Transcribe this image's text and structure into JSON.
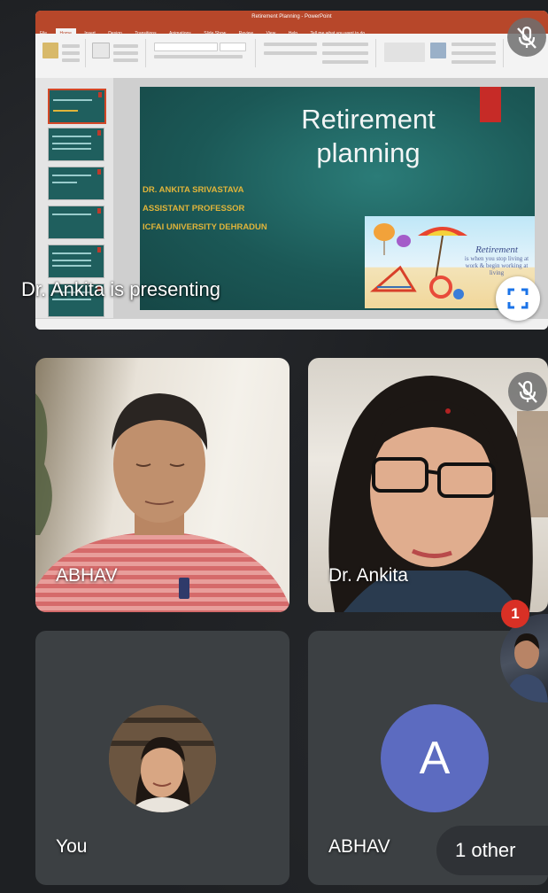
{
  "presentation": {
    "window_title": "Retirement Planning - PowerPoint",
    "ribbon_tabs": [
      "File",
      "Home",
      "Insert",
      "Design",
      "Transitions",
      "Animations",
      "Slide Show",
      "Review",
      "View",
      "Help",
      "Tell me what you want to do"
    ],
    "slide": {
      "title_line1": "Retirement",
      "title_line2": "planning",
      "author": "DR. ANKITA SRIVASTAVA",
      "role": "ASSISTANT PROFESSOR",
      "institution": "ICFAI UNIVERSITY DEHRADUN",
      "picture_heading": "Retirement",
      "picture_caption": "is when you stop living at work & begin working at living"
    },
    "thumbnail_count": 6,
    "presenting_label": "Dr. Ankita is presenting"
  },
  "participants": {
    "abhav_video_name": "ABHAV",
    "ankita_video_name": "Dr. Ankita",
    "self_name": "You",
    "abhav_avatar_letter": "A",
    "abhav_avatar_name": "ABHAV",
    "others_label": "1 other",
    "notification_count": "1"
  },
  "colors": {
    "background": "#1f2124",
    "tile": "#3c4043",
    "avatar_accent": "#5c6bc0",
    "badge": "#d93025",
    "ppt_accent": "#b7472a"
  }
}
